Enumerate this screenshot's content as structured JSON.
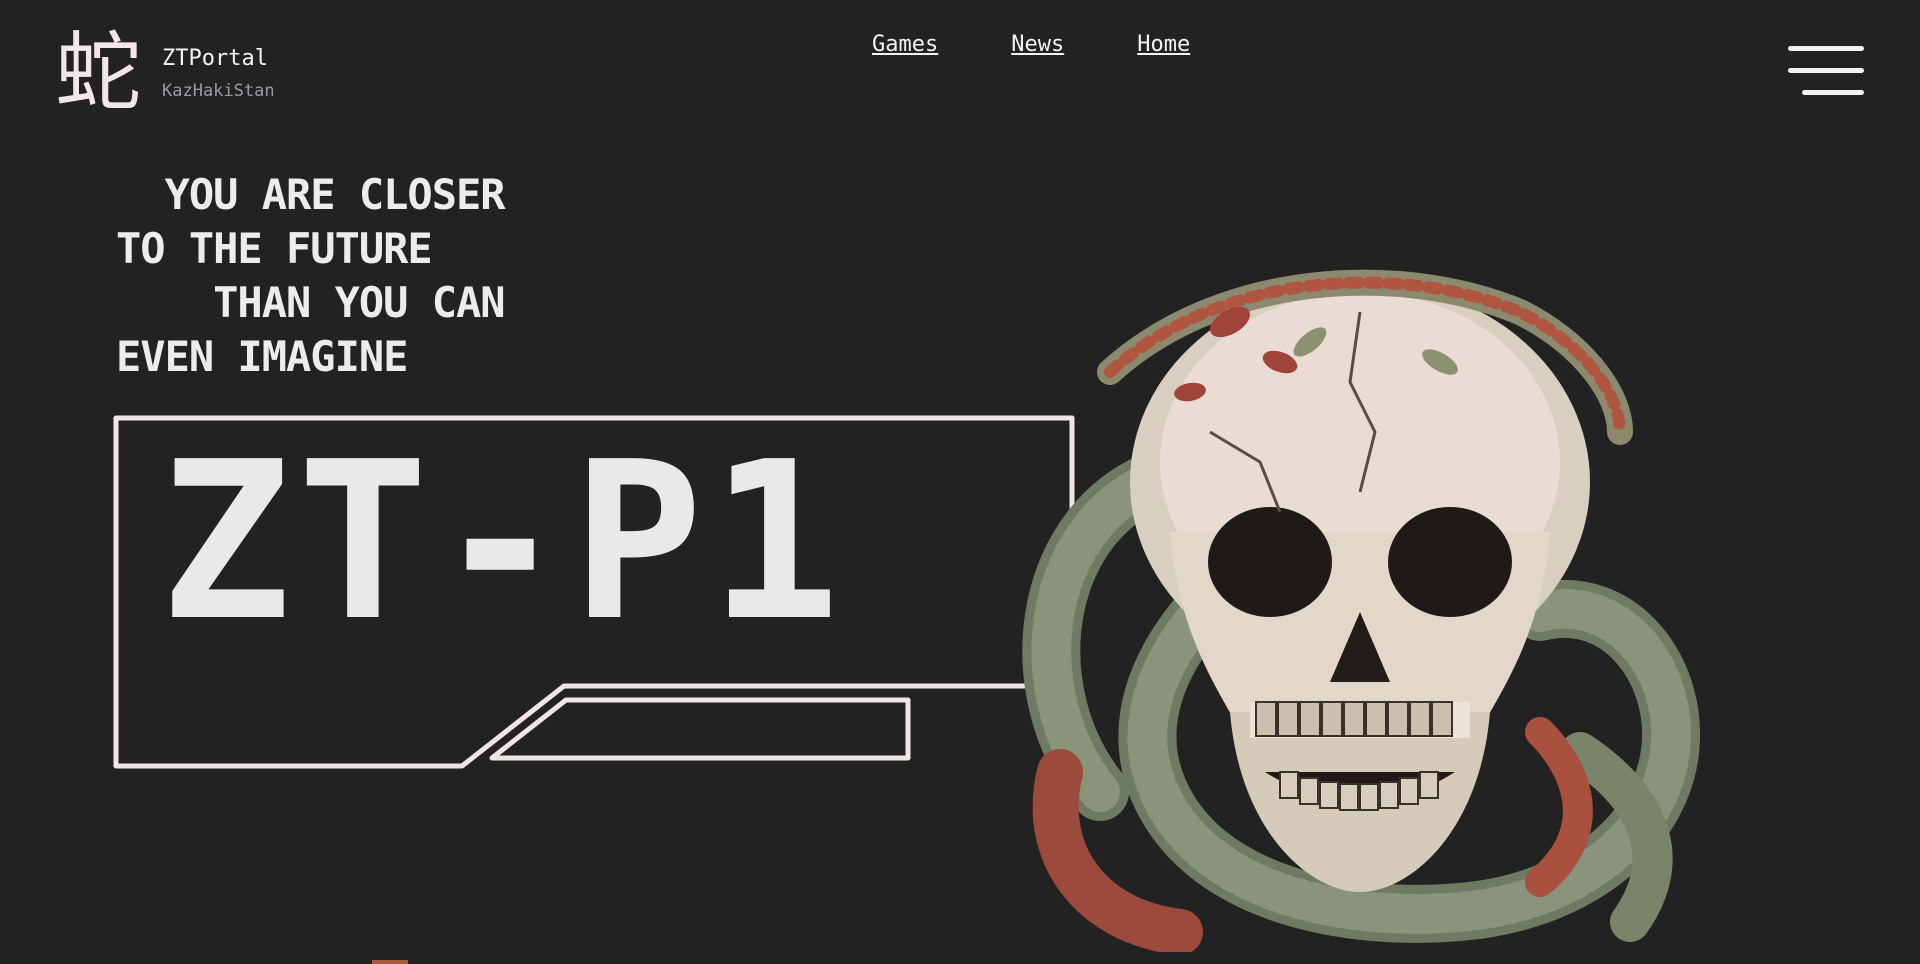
{
  "brand": {
    "glyph": "蛇",
    "title": "ZTPortal",
    "subtitle": "KazHakiStan"
  },
  "nav": {
    "items": [
      {
        "label": "Games"
      },
      {
        "label": "News"
      },
      {
        "label": "Home"
      }
    ]
  },
  "menu": {
    "icon": "hamburger-menu-icon"
  },
  "hero": {
    "tagline": [
      "  YOU ARE CLOSER",
      "TO THE FUTURE",
      "    THAN YOU CAN",
      "EVEN IMAGINE"
    ],
    "product_name": "ZT-P1",
    "art": "skull-with-snakes-illustration"
  },
  "colors": {
    "background": "#222222",
    "text": "#efefef",
    "frame": "#f1e4e4",
    "muted": "#9a9aa6"
  }
}
